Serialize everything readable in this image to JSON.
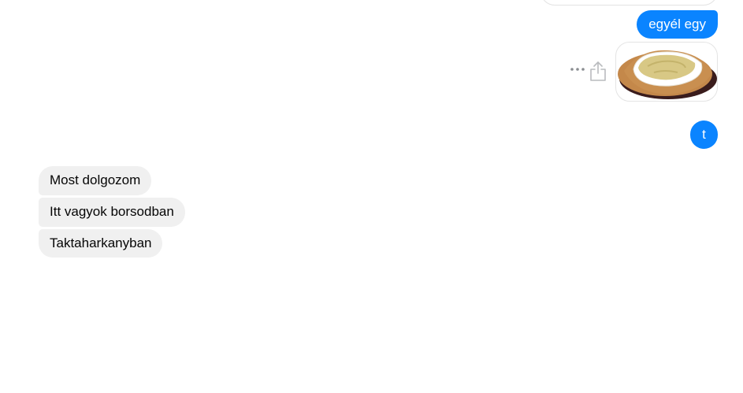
{
  "conversation": {
    "sent": {
      "message_1": "egyél egy",
      "message_2": "t"
    },
    "received": [
      "Most dolgozom",
      "Itt vagyok borsodban",
      "Taktaharkanyban"
    ]
  },
  "sticker": {
    "icon": "langos-food-icon"
  },
  "actions": {
    "more_icon": "ellipsis-icon",
    "share_icon": "share-icon"
  },
  "colors": {
    "outgoing_bubble": "#0a84ff",
    "incoming_bubble": "#f0f0f0"
  }
}
